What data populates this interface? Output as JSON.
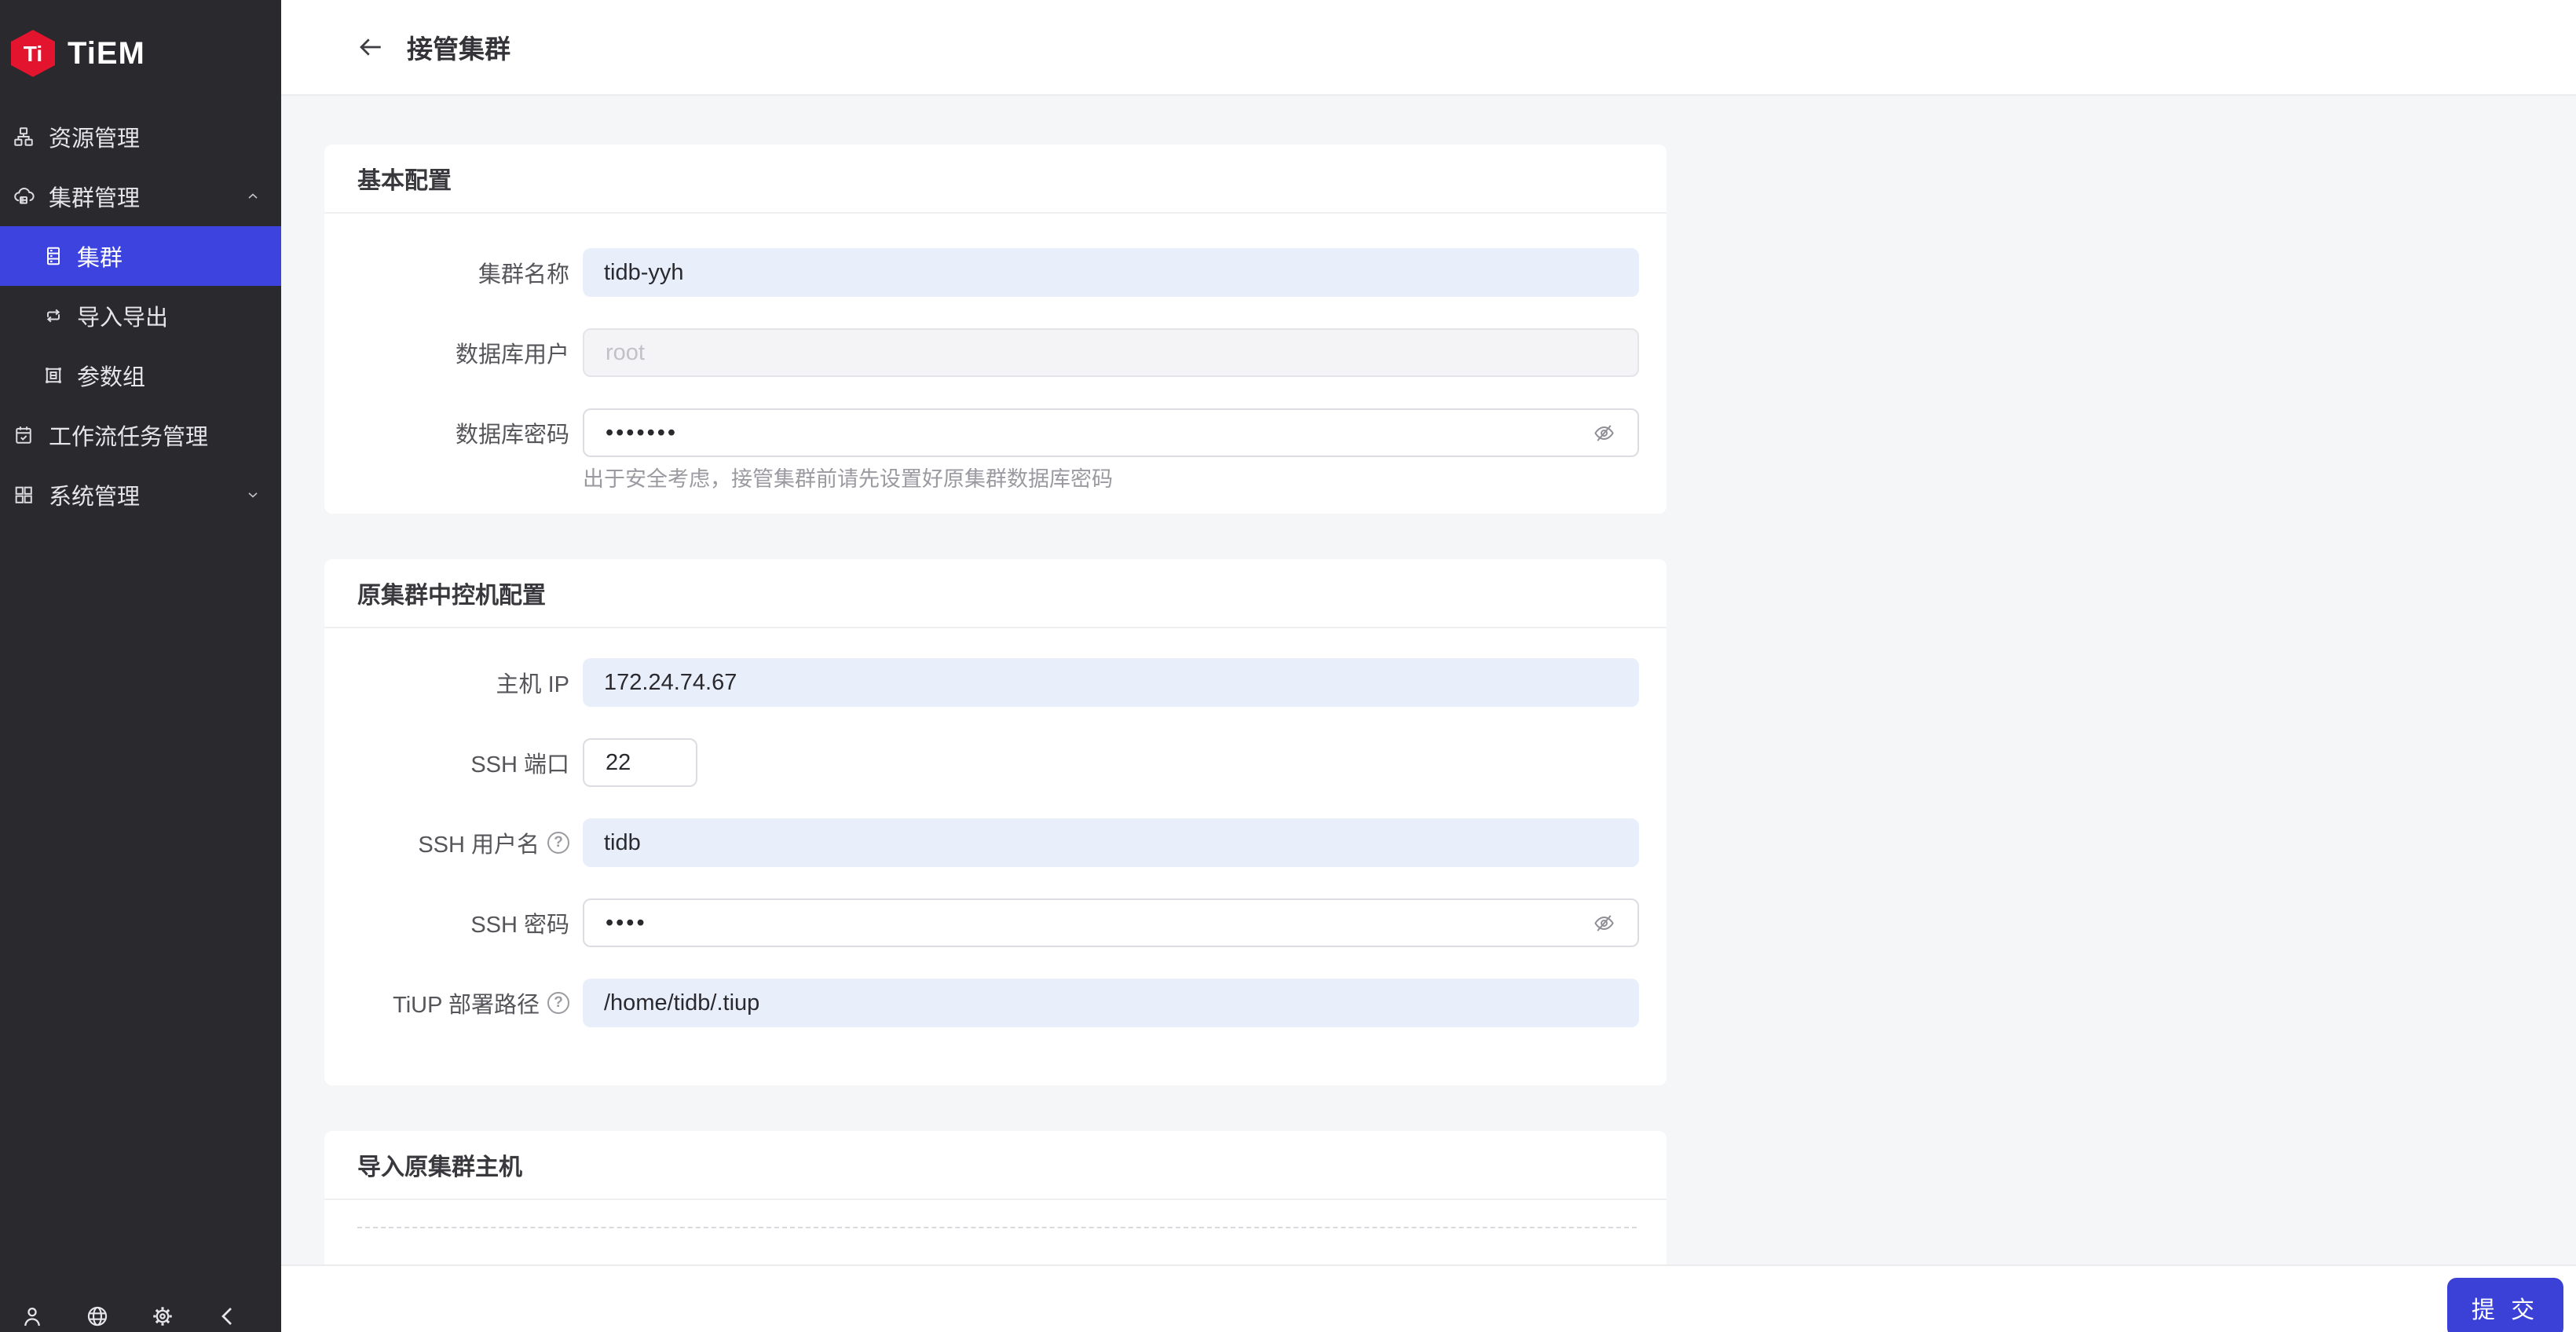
{
  "brand": {
    "name": "TiEM",
    "logo_glyph": "Ti"
  },
  "colors": {
    "accent": "#3b41d6",
    "sidebar_bg": "#2a2a2e",
    "selected_item_bg": "#3c43de",
    "brand_red": "#e2142e",
    "filled_input_bg": "#e9eefb",
    "content_bg": "#f5f6f8"
  },
  "sidebar": {
    "items": [
      {
        "label": "资源管理",
        "icon": "resources-icon"
      },
      {
        "label": "集群管理",
        "icon": "cluster-management-icon",
        "expanded": true
      },
      {
        "label": "集群",
        "icon": "cluster-icon",
        "selected": true
      },
      {
        "label": "导入导出",
        "icon": "import-export-icon"
      },
      {
        "label": "参数组",
        "icon": "parameter-group-icon"
      },
      {
        "label": "工作流任务管理",
        "icon": "workflow-icon"
      },
      {
        "label": "系统管理",
        "icon": "system-icon",
        "collapsed": true
      }
    ]
  },
  "header": {
    "title": "接管集群"
  },
  "basic_config": {
    "title": "基本配置",
    "cluster_name": {
      "label": "集群名称",
      "value": "tidb-yyh"
    },
    "db_user": {
      "label": "数据库用户",
      "placeholder": "root"
    },
    "db_password": {
      "label": "数据库密码",
      "value": "•••••••",
      "hint": "出于安全考虑，接管集群前请先设置好原集群数据库密码"
    }
  },
  "control_machine": {
    "title": "原集群中控机配置",
    "host_ip": {
      "label": "主机 IP",
      "value": "172.24.74.67"
    },
    "ssh_port": {
      "label": "SSH 端口",
      "value": "22"
    },
    "ssh_user": {
      "label": "SSH 用户名",
      "value": "tidb"
    },
    "ssh_password": {
      "label": "SSH 密码",
      "value": "••••"
    },
    "tiup_path": {
      "label": "TiUP 部署路径",
      "value": "/home/tidb/.tiup"
    }
  },
  "import_hosts": {
    "title": "导入原集群主机"
  },
  "footer": {
    "submit_label": "提 交"
  },
  "misc": {
    "help_glyph": "?"
  }
}
